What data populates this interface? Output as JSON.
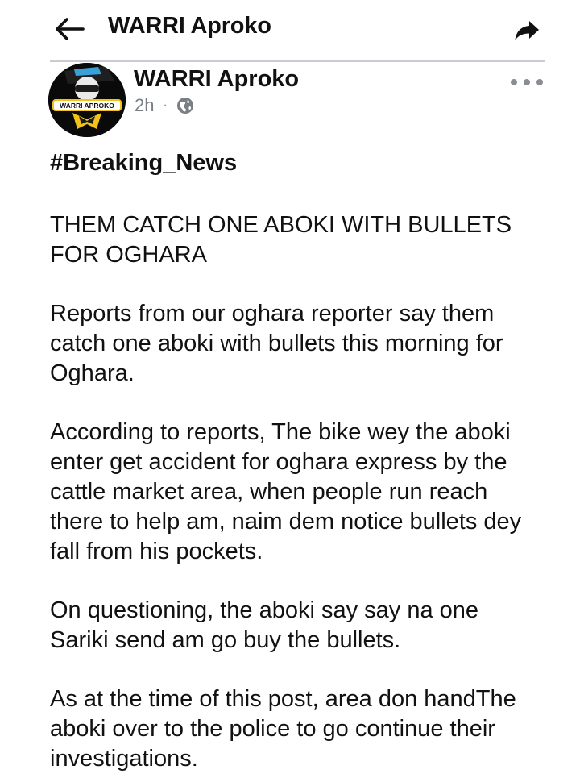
{
  "topbar": {
    "back_icon": "arrow-left-icon",
    "title": "WARRI Aproko",
    "share_icon": "share-arrow-icon"
  },
  "post": {
    "author": "WARRI Aproko",
    "avatar_text": "WARRI APROKO",
    "time": "2h",
    "separator": "·",
    "privacy_icon": "globe-icon",
    "more_icon": "more-dots-icon",
    "hashtag": "#Breaking_News",
    "headline_line1": "THEM CATCH ONE ABOKI WITH BULLETS",
    "headline_line2": "FOR OGHARA",
    "p1_line1": "Reports from our oghara reporter say them",
    "p1_line2": "catch one aboki with bullets this morning for",
    "p1_line3": "Oghara.",
    "p2_line1": "According to reports, The bike wey the aboki",
    "p2_line2": "enter get accident for  oghara express by the",
    "p2_line3": "cattle market area, when people run reach",
    "p2_line4": "there to help am, naim dem notice bullets dey",
    "p2_line5": "fall from his pockets.",
    "p3_line1": "On questioning, the aboki say say na one",
    "p3_line2": "Sariki send am go buy the bullets.",
    "p4_line1": "As at the time of this post, area don handThe",
    "p4_line2": "aboki over to the police to go continue their",
    "p4_line3": "investigations."
  },
  "colors": {
    "text": "#111111",
    "meta_gray": "#7a7f86",
    "divider": "#c9ccd1",
    "avatar_yellow": "#f2c21b",
    "avatar_blue": "#3aa0d8"
  }
}
